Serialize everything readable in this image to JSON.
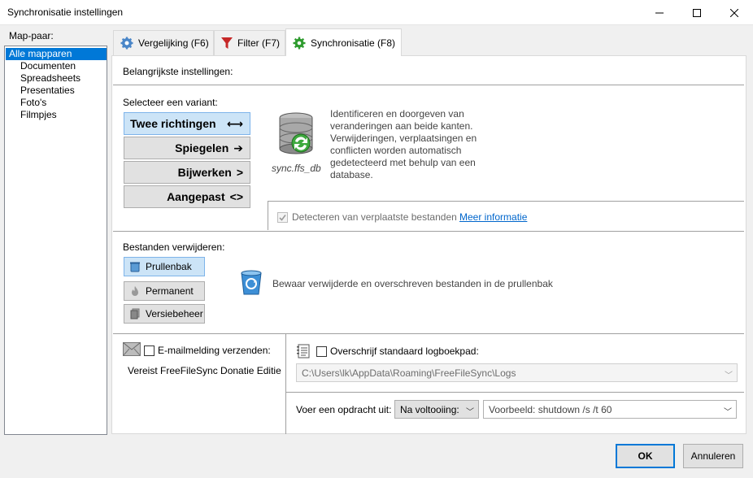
{
  "window": {
    "title": "Synchronisatie instellingen"
  },
  "left_panel": {
    "label": "Map-paar:",
    "items": [
      "Alle mapparen",
      "Documenten",
      "Spreadsheets",
      "Presentaties",
      "Foto's",
      "Filmpjes"
    ]
  },
  "tabs": [
    {
      "label": "Vergelijking (F6)",
      "icon": "gear-icon"
    },
    {
      "label": "Filter (F7)",
      "icon": "funnel-icon"
    },
    {
      "label": "Synchronisatie (F8)",
      "icon": "sync-gear-icon"
    }
  ],
  "main": {
    "header": "Belangrijkste instellingen:",
    "variant_label": "Selecteer een variant:",
    "variants": [
      {
        "label": "Twee richtingen",
        "glyph": "⟷"
      },
      {
        "label": "Spiegelen",
        "glyph": "➔"
      },
      {
        "label": "Bijwerken",
        "glyph": ">"
      },
      {
        "label": "Aangepast",
        "glyph": "<>"
      }
    ],
    "db_caption": "sync.ffs_db",
    "description": "Identificeren en doorgeven van veranderingen aan beide kanten. Verwijderingen, verplaatsingen en conflicten worden automatisch gedetecteerd met behulp van een database.",
    "detect_moved_label": "Detecteren van verplaatste bestanden",
    "more_info_link": "Meer informatie",
    "delete_label": "Bestanden verwijderen:",
    "delete_options": [
      "Prullenbak",
      "Permanent",
      "Versiebeheer"
    ],
    "delete_description": "Bewaar verwijderde en overschreven bestanden in de prullenbak",
    "email_label": "E-mailmelding verzenden:",
    "donation_note": "Vereist FreeFileSync Donatie Editie",
    "logfile_label": "Overschrijf standaard logboekpad:",
    "logfile_path": "C:\\Users\\lk\\AppData\\Roaming\\FreeFileSync\\Logs",
    "run_command_label": "Voer een opdracht uit:",
    "run_command_when": "Na voltooiing:",
    "run_command_placeholder": "Voorbeeld: shutdown /s /t 60"
  },
  "buttons": {
    "ok": "OK",
    "cancel": "Annuleren"
  },
  "colors": {
    "selection": "#0078d7",
    "active_button": "#cce4f7",
    "link": "#0066cc"
  }
}
